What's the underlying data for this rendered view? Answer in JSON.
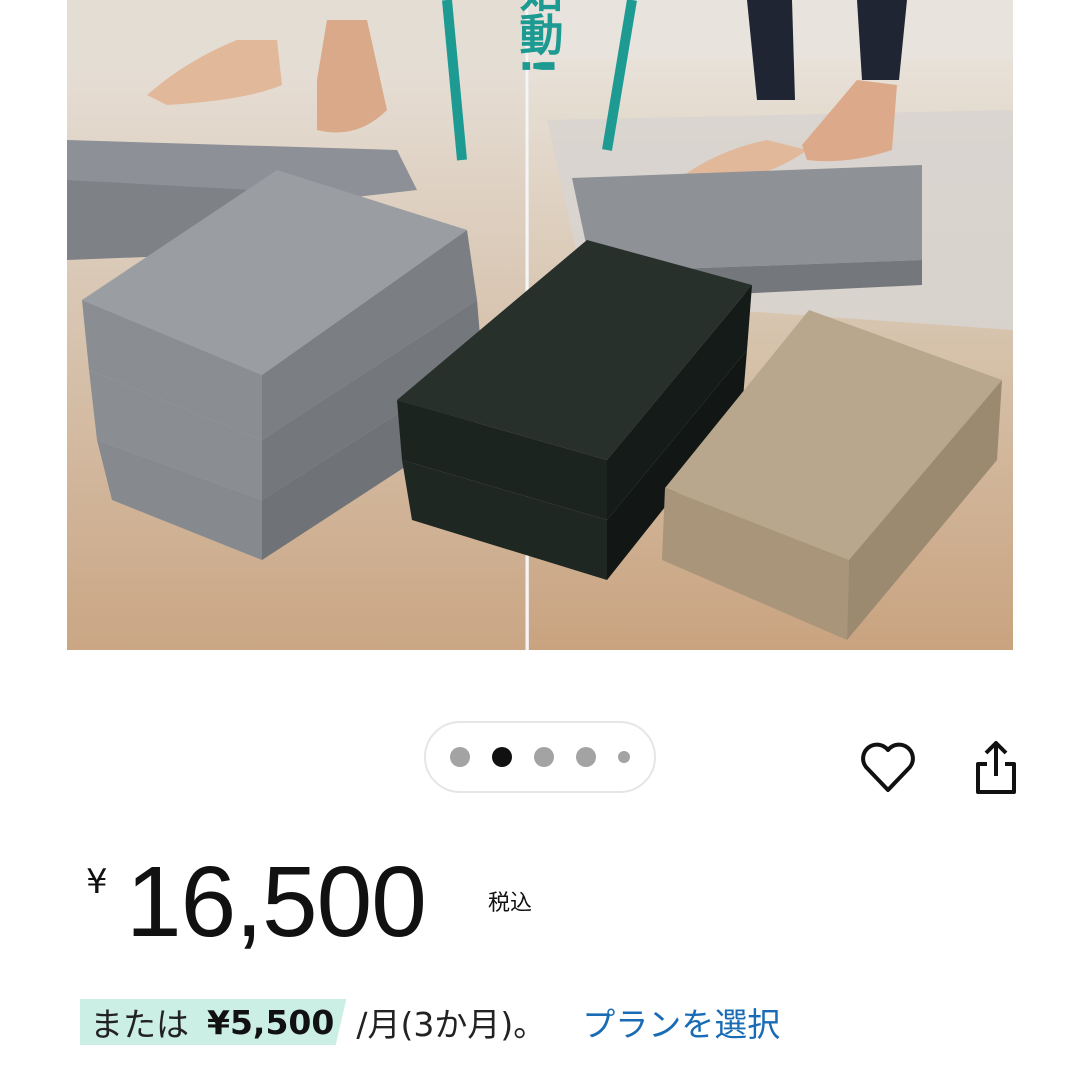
{
  "image": {
    "overlay_text": "再始動!",
    "colors": {
      "gray": "#8e9196",
      "black": "#1e2622",
      "beige": "#b7a58c",
      "teal": "#1d9a92"
    }
  },
  "carousel": {
    "total": 5,
    "active_index": 1
  },
  "actions": {
    "favorite_icon": "heart-icon",
    "share_icon": "share-icon"
  },
  "price": {
    "currency": "¥",
    "amount": "16,500",
    "tax_note": "税込"
  },
  "installment": {
    "prefix": "または",
    "monthly": "¥5,500",
    "term": "/月(3か月)。",
    "plan_link": "プランを選択",
    "highlight_color": "#cbeee5",
    "link_color": "#1a6bb5"
  }
}
